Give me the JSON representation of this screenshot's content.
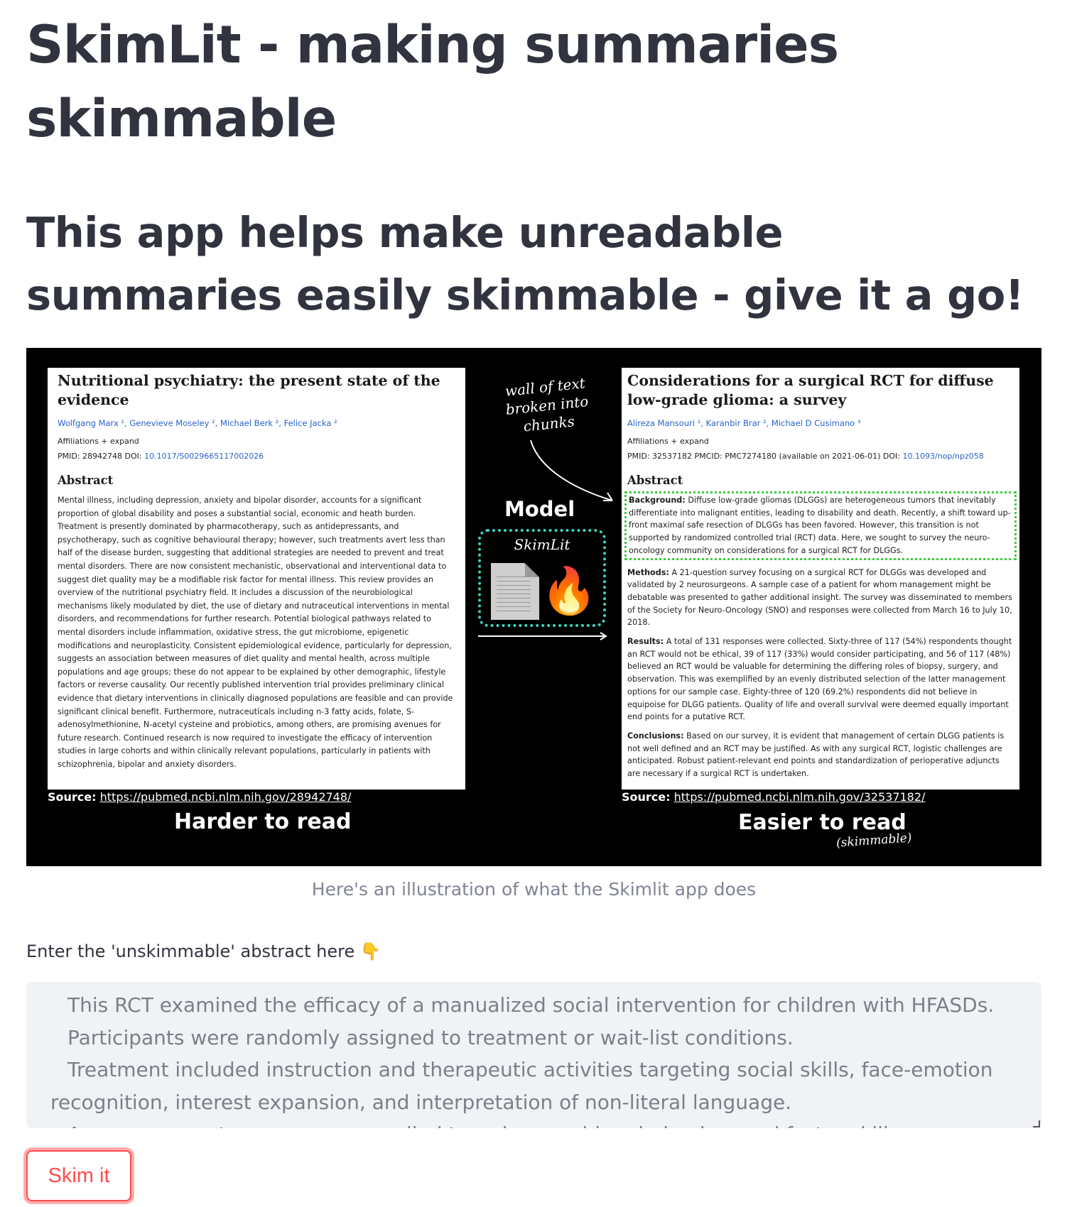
{
  "page": {
    "title": "SkimLit - making summaries skimmable",
    "subtitle": "This app helps make unreadable summaries easily skimmable - give it a go!"
  },
  "illustration": {
    "caption": "Here's an illustration of what the Skimlit app does",
    "hand_note": "wall of text broken into chunks",
    "model_label": "Model",
    "model_name": "SkimLit",
    "left_panel": {
      "paper_title": "Nutritional psychiatry: the present state of the evidence",
      "authors": "Wolfgang Marx ¹, Genevieve Moseley ², Michael Berk ², Felice Jacka ²",
      "affiliations": "Affiliations  + expand",
      "pmid_line": "PMID: 28942748   DOI: ",
      "doi": "10.1017/S0029665117002026",
      "abstract_heading": "Abstract",
      "abstract_text": "Mental illness, including depression, anxiety and bipolar disorder, accounts for a significant proportion of global disability and poses a substantial social, economic and heath burden. Treatment is presently dominated by pharmacotherapy, such as antidepressants, and psychotherapy, such as cognitive behavioural therapy; however, such treatments avert less than half of the disease burden, suggesting that additional strategies are needed to prevent and treat mental disorders. There are now consistent mechanistic, observational and interventional data to suggest diet quality may be a modifiable risk factor for mental illness. This review provides an overview of the nutritional psychiatry field. It includes a discussion of the neurobiological mechanisms likely modulated by diet, the use of dietary and nutraceutical interventions in mental disorders, and recommendations for further research. Potential biological pathways related to mental disorders include inflammation, oxidative stress, the gut microbiome, epigenetic modifications and neuroplasticity. Consistent epidemiological evidence, particularly for depression, suggests an association between measures of diet quality and mental health, across multiple populations and age groups; these do not appear to be explained by other demographic, lifestyle factors or reverse causality. Our recently published intervention trial provides preliminary clinical evidence that dietary interventions in clinically diagnosed populations are feasible and can provide significant clinical benefit. Furthermore, nutraceuticals including n-3 fatty acids, folate, S-adenosylmethionine, N-acetyl cysteine and probiotics, among others, are promising avenues for future research. Continued research is now required to investigate the efficacy of intervention studies in large cohorts and within clinically relevant populations, particularly in patients with schizophrenia, bipolar and anxiety disorders.",
      "source_label": "Source:",
      "source_url": "https://pubmed.ncbi.nlm.nih.gov/28942748/",
      "caption": "Harder to read"
    },
    "right_panel": {
      "paper_title": "Considerations for a surgical RCT for diffuse low-grade glioma: a survey",
      "authors": "Alireza Mansouri ¹, Karanbir Brar ², Michael D Cusimano ³",
      "affiliations": "Affiliations  + expand",
      "pmid_line": "PMID: 32537182   PMCID: PMC7274180 (available on 2021-06-01)   DOI: ",
      "doi": "10.1093/nop/npz058",
      "abstract_heading": "Abstract",
      "background_label": "Background:",
      "background_text": "Diffuse low-grade gliomas (DLGGs) are heterogeneous tumors that inevitably differentiate into malignant entities, leading to disability and death. Recently, a shift toward up-front maximal safe resection of DLGGs has been favored. However, this transition is not supported by randomized controlled trial (RCT) data. Here, we sought to survey the neuro-oncology community on considerations for a surgical RCT for DLGGs.",
      "methods_label": "Methods:",
      "methods_text": "A 21-question survey focusing on a surgical RCT for DLGGs was developed and validated by 2 neurosurgeons. A sample case of a patient for whom management might be debatable was presented to gather additional insight. The survey was disseminated to members of the Society for Neuro-Oncology (SNO) and responses were collected from March 16 to July 10, 2018.",
      "results_label": "Results:",
      "results_text": "A total of 131 responses were collected. Sixty-three of 117 (54%) respondents thought an RCT would not be ethical, 39 of 117 (33%) would consider participating, and 56 of 117 (48%) believed an RCT would be valuable for determining the differing roles of biopsy, surgery, and observation. This was exemplified by an evenly distributed selection of the latter management options for our sample case. Eighty-three of 120 (69.2%) respondents did not believe in equipoise for DLGG patients. Quality of life and overall survival were deemed equally important end points for a putative RCT.",
      "conclusions_label": "Conclusions:",
      "conclusions_text": "Based on our survey, it is evident that management of certain DLGG patients is not well defined and an RCT may be justified. As with any surgical RCT, logistic challenges are anticipated. Robust patient-relevant end points and standardization of perioperative adjuncts are necessary if a surgical RCT is undertaken.",
      "source_label": "Source:",
      "source_url": "https://pubmed.ncbi.nlm.nih.gov/32537182/",
      "caption": "Easier to read",
      "caption_note": "(skimmable)"
    }
  },
  "input": {
    "label": "Enter the 'unskimmable' abstract here 👇",
    "lines": [
      "This RCT examined the efficacy of a manualized social intervention for children with HFASDs.",
      "Participants were randomly assigned to treatment or wait-list conditions.",
      "Treatment included instruction and therapeutic activities targeting social skills, face-emotion recognition, interest expansion, and interpretation of non-literal language.",
      "A response-cost program was applied to reduce problem behaviors and foster skills acquisition."
    ]
  },
  "actions": {
    "skim_button": "Skim it"
  }
}
